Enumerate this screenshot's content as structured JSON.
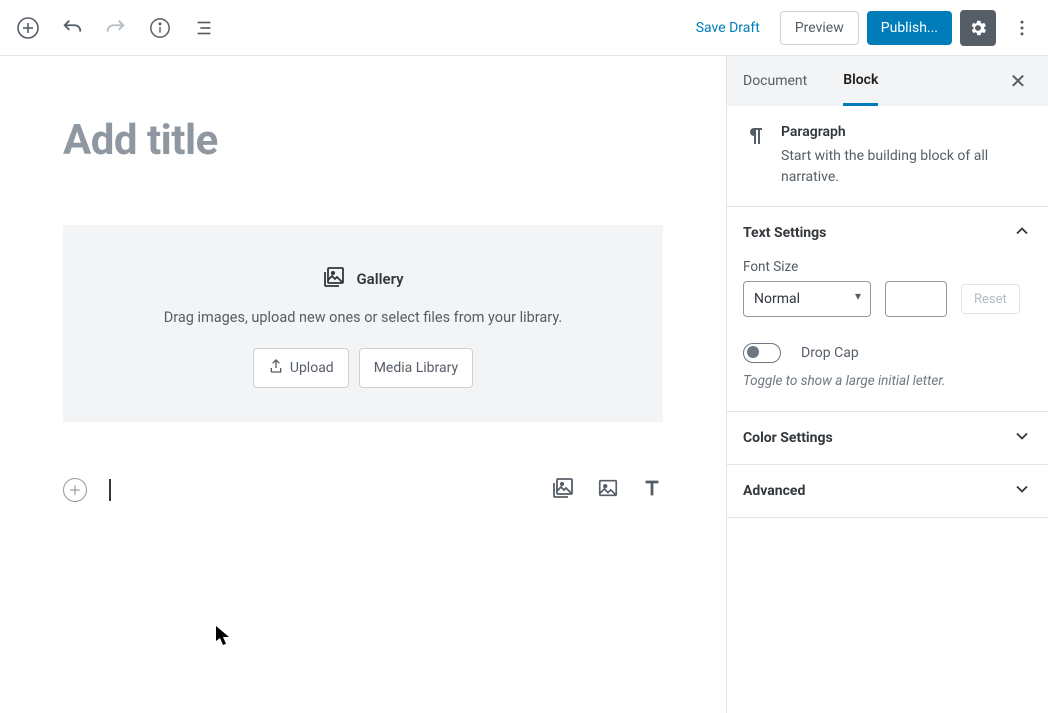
{
  "toolbar": {
    "save_draft": "Save Draft",
    "preview": "Preview",
    "publish": "Publish..."
  },
  "editor": {
    "title_placeholder": "Add title",
    "gallery": {
      "label": "Gallery",
      "desc": "Drag images, upload new ones or select files from your library.",
      "upload": "Upload",
      "media_library": "Media Library"
    }
  },
  "sidebar": {
    "tabs": {
      "document": "Document",
      "block": "Block"
    },
    "paragraph": {
      "title": "Paragraph",
      "desc": "Start with the building block of all narrative."
    },
    "text_settings": {
      "title": "Text Settings",
      "font_size_label": "Font Size",
      "font_size_value": "Normal",
      "reset": "Reset",
      "drop_cap": "Drop Cap",
      "drop_cap_hint": "Toggle to show a large initial letter."
    },
    "color_settings": "Color Settings",
    "advanced": "Advanced"
  }
}
